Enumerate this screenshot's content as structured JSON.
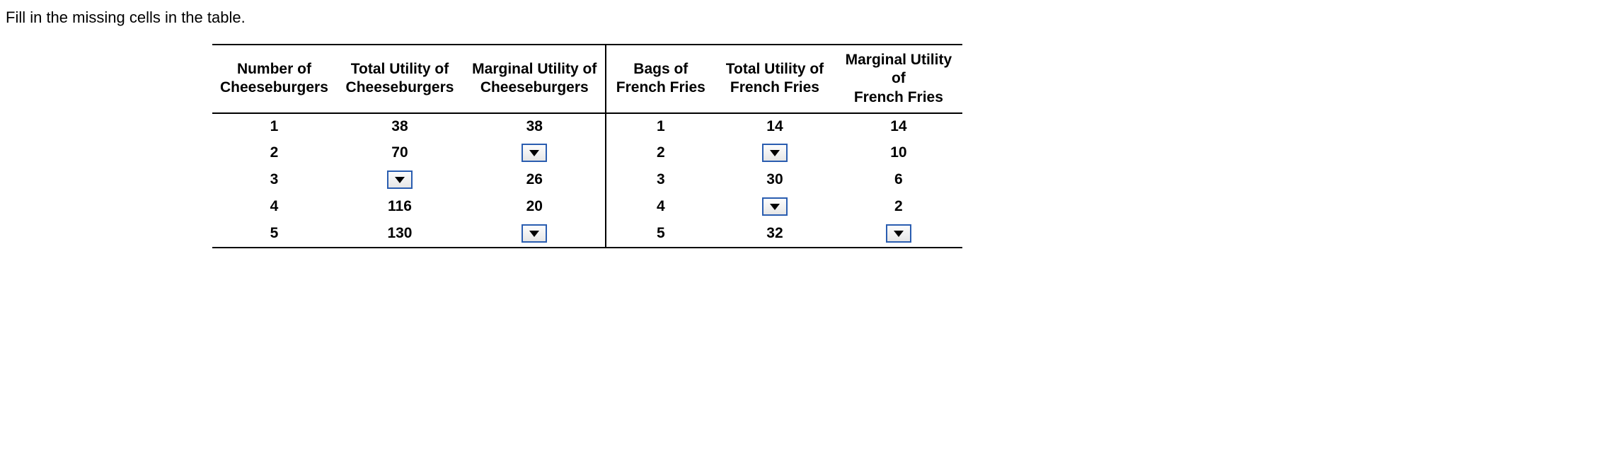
{
  "instruction": "Fill in the missing cells in the table.",
  "headers": {
    "col1_line1": "Number of",
    "col1_line2": "Cheeseburgers",
    "col2_line1": "Total Utility of",
    "col2_line2": "Cheeseburgers",
    "col3_line1": "Marginal Utility of",
    "col3_line2": "Cheeseburgers",
    "col4_line1": "Bags of",
    "col4_line2": "French Fries",
    "col5_line1": "Total Utility of",
    "col5_line2": "French Fries",
    "col6_line1": "Marginal Utility of",
    "col6_line2": "French Fries"
  },
  "rows": [
    {
      "num_cb": "1",
      "tu_cb": "38",
      "mu_cb": "38",
      "num_ff": "1",
      "tu_ff": "14",
      "mu_ff": "14"
    },
    {
      "num_cb": "2",
      "tu_cb": "70",
      "mu_cb": "",
      "num_ff": "2",
      "tu_ff": "",
      "mu_ff": "10"
    },
    {
      "num_cb": "3",
      "tu_cb": "",
      "mu_cb": "26",
      "num_ff": "3",
      "tu_ff": "30",
      "mu_ff": "6"
    },
    {
      "num_cb": "4",
      "tu_cb": "116",
      "mu_cb": "20",
      "num_ff": "4",
      "tu_ff": "",
      "mu_ff": "2"
    },
    {
      "num_cb": "5",
      "tu_cb": "130",
      "mu_cb": "",
      "num_ff": "5",
      "tu_ff": "32",
      "mu_ff": ""
    }
  ],
  "dropdowns": [
    {
      "row": 1,
      "col": "mu_cb"
    },
    {
      "row": 1,
      "col": "tu_ff"
    },
    {
      "row": 2,
      "col": "tu_cb"
    },
    {
      "row": 3,
      "col": "tu_ff"
    },
    {
      "row": 4,
      "col": "mu_cb"
    },
    {
      "row": 4,
      "col": "mu_ff"
    }
  ]
}
